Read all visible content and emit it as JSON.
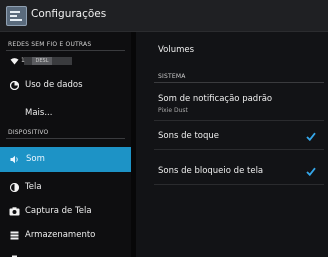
{
  "header": {
    "title": "Configurações"
  },
  "left": {
    "section_wireless": "REDES SEM FIO E OUTRAS",
    "wifi_toggle": {
      "number": "1",
      "state": "DESL"
    },
    "items": {
      "data_usage": "Uso de dados",
      "more": "Mais..."
    },
    "section_device": "DISPOSITIVO",
    "device_items": {
      "sound": "Som",
      "display": "Tela",
      "screenshot": "Captura de Tela",
      "storage": "Armazenamento"
    }
  },
  "right": {
    "volumes": "Volumes",
    "section_system": "SISTEMA",
    "notification_sound": {
      "label": "Som de notificação padrão",
      "value": "Pixie Dust"
    },
    "touch_sounds": {
      "label": "Sons de toque",
      "checked": true
    },
    "lock_sounds": {
      "label": "Sons de bloqueio de tela",
      "checked": true
    }
  },
  "colors": {
    "accent": "#1d93c6",
    "check": "#35a7ea"
  }
}
